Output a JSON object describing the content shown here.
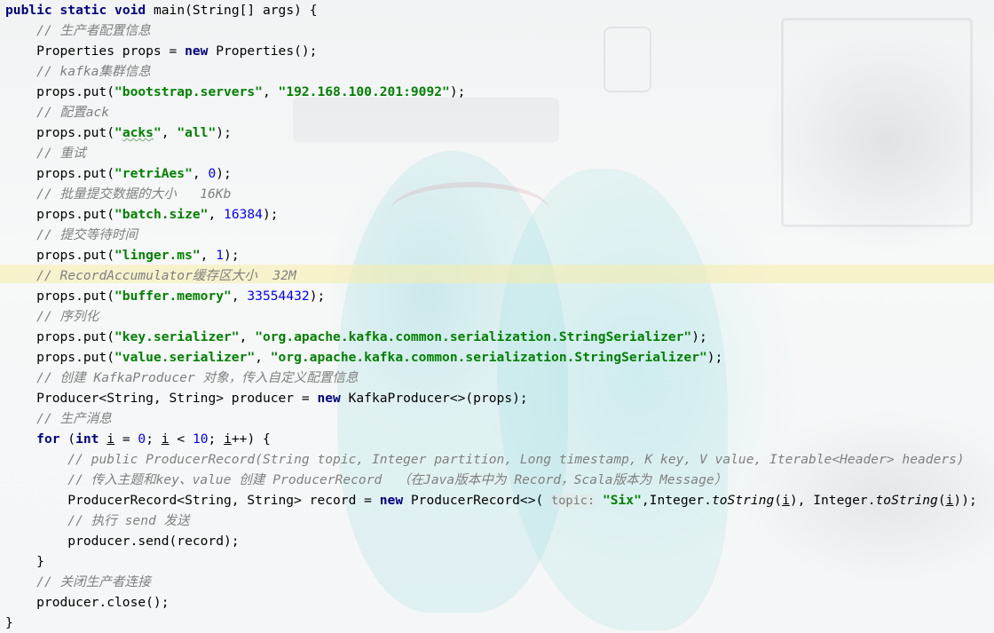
{
  "editor": {
    "lines": [
      {
        "segments": [
          {
            "t": "public",
            "c": "kw"
          },
          {
            "t": " "
          },
          {
            "t": "static",
            "c": "kw"
          },
          {
            "t": " "
          },
          {
            "t": "void",
            "c": "kw"
          },
          {
            "t": " main(String[] args) {"
          }
        ]
      },
      {
        "segments": [
          {
            "t": "    "
          },
          {
            "t": "// 生产者配置信息",
            "c": "cmt"
          }
        ]
      },
      {
        "segments": [
          {
            "t": "    Properties props = "
          },
          {
            "t": "new",
            "c": "kw"
          },
          {
            "t": " Properties();"
          }
        ]
      },
      {
        "segments": [
          {
            "t": "    "
          },
          {
            "t": "// kafka集群信息",
            "c": "cmt"
          }
        ]
      },
      {
        "segments": [
          {
            "t": "    props.put("
          },
          {
            "t": "\"bootstrap.servers\"",
            "c": "str"
          },
          {
            "t": ", "
          },
          {
            "t": "\"192.168.100.201:9092\"",
            "c": "str"
          },
          {
            "t": ");"
          }
        ]
      },
      {
        "segments": [
          {
            "t": "    "
          },
          {
            "t": "// 配置ack",
            "c": "cmt"
          }
        ]
      },
      {
        "segments": [
          {
            "t": "    props.put("
          },
          {
            "t": "\"",
            "c": "str"
          },
          {
            "t": "acks",
            "c": "str wavy"
          },
          {
            "t": "\"",
            "c": "str"
          },
          {
            "t": ", "
          },
          {
            "t": "\"all\"",
            "c": "str"
          },
          {
            "t": ");"
          }
        ]
      },
      {
        "segments": [
          {
            "t": "    "
          },
          {
            "t": "// 重试",
            "c": "cmt"
          }
        ]
      },
      {
        "segments": [
          {
            "t": "    props.put("
          },
          {
            "t": "\"retriAes\"",
            "c": "str"
          },
          {
            "t": ", "
          },
          {
            "t": "0",
            "c": "num"
          },
          {
            "t": ");"
          }
        ]
      },
      {
        "segments": [
          {
            "t": "    "
          },
          {
            "t": "// 批量提交数据的大小   16Kb",
            "c": "cmt"
          }
        ]
      },
      {
        "segments": [
          {
            "t": "    props.put("
          },
          {
            "t": "\"batch.size\"",
            "c": "str"
          },
          {
            "t": ", "
          },
          {
            "t": "16384",
            "c": "num"
          },
          {
            "t": ");"
          }
        ]
      },
      {
        "segments": [
          {
            "t": "    "
          },
          {
            "t": "// 提交等待时间",
            "c": "cmt"
          }
        ]
      },
      {
        "segments": [
          {
            "t": "    props.put("
          },
          {
            "t": "\"linger.ms\"",
            "c": "str"
          },
          {
            "t": ", "
          },
          {
            "t": "1",
            "c": "num"
          },
          {
            "t": ");"
          }
        ]
      },
      {
        "segments": [
          {
            "t": "    "
          },
          {
            "t": "// RecordAccumulator缓存区大小  32M",
            "c": "cmt"
          }
        ]
      },
      {
        "segments": [
          {
            "t": "    props.put("
          },
          {
            "t": "\"buffer.memory\"",
            "c": "str"
          },
          {
            "t": ", "
          },
          {
            "t": "33554432",
            "c": "num"
          },
          {
            "t": ");"
          }
        ]
      },
      {
        "segments": [
          {
            "t": "    "
          },
          {
            "t": "// 序列化",
            "c": "cmt"
          }
        ]
      },
      {
        "segments": [
          {
            "t": "    props.put("
          },
          {
            "t": "\"key.serializer\"",
            "c": "str"
          },
          {
            "t": ", "
          },
          {
            "t": "\"org.apache.kafka.common.serialization.StringSerializer\"",
            "c": "str"
          },
          {
            "t": ");"
          }
        ]
      },
      {
        "segments": [
          {
            "t": "    props.put("
          },
          {
            "t": "\"value.serializer\"",
            "c": "str"
          },
          {
            "t": ", "
          },
          {
            "t": "\"org.apache.kafka.common.serialization.StringSerializer\"",
            "c": "str"
          },
          {
            "t": ");"
          }
        ]
      },
      {
        "segments": [
          {
            "t": "    "
          },
          {
            "t": "// 创建 KafkaProducer 对象，传入自定义配置信息",
            "c": "cmt"
          }
        ]
      },
      {
        "segments": [
          {
            "t": "    Producer<String, String> producer = "
          },
          {
            "t": "new",
            "c": "kw"
          },
          {
            "t": " KafkaProducer<>(props);"
          }
        ]
      },
      {
        "segments": [
          {
            "t": "    "
          },
          {
            "t": "// 生产消息",
            "c": "cmt"
          }
        ]
      },
      {
        "segments": [
          {
            "t": "    "
          },
          {
            "t": "for",
            "c": "kw"
          },
          {
            "t": " ("
          },
          {
            "t": "int",
            "c": "kw"
          },
          {
            "t": " "
          },
          {
            "t": "i",
            "c": "uvar"
          },
          {
            "t": " = "
          },
          {
            "t": "0",
            "c": "num"
          },
          {
            "t": "; "
          },
          {
            "t": "i",
            "c": "uvar"
          },
          {
            "t": " < "
          },
          {
            "t": "10",
            "c": "num"
          },
          {
            "t": "; "
          },
          {
            "t": "i",
            "c": "uvar"
          },
          {
            "t": "++) {"
          }
        ]
      },
      {
        "segments": [
          {
            "t": "        "
          },
          {
            "t": "// public ProducerRecord(String topic, Integer partition, Long timestamp, K key, V value, Iterable<Header> headers)",
            "c": "cmt"
          }
        ]
      },
      {
        "segments": [
          {
            "t": "        "
          },
          {
            "t": "// 传入主题和key、value 创建 ProducerRecord  （在Java版本中为 Record，Scala版本为 Message）",
            "c": "cmt"
          }
        ]
      },
      {
        "segments": [
          {
            "t": "        ProducerRecord<String, String> record = "
          },
          {
            "t": "new",
            "c": "kw"
          },
          {
            "t": " ProducerRecord<>( "
          },
          {
            "t": "topic:",
            "c": "hint"
          },
          {
            "t": " "
          },
          {
            "t": "\"Six\"",
            "c": "str"
          },
          {
            "t": ",Integer."
          },
          {
            "t": "toString",
            "c": "mcall"
          },
          {
            "t": "("
          },
          {
            "t": "i",
            "c": "uvar"
          },
          {
            "t": "), Integer."
          },
          {
            "t": "toString",
            "c": "mcall"
          },
          {
            "t": "("
          },
          {
            "t": "i",
            "c": "uvar"
          },
          {
            "t": "));"
          }
        ]
      },
      {
        "segments": [
          {
            "t": "        "
          },
          {
            "t": "// 执行 send 发送",
            "c": "cmt"
          }
        ]
      },
      {
        "segments": [
          {
            "t": "        producer.send(record);"
          }
        ]
      },
      {
        "segments": [
          {
            "t": "    }"
          }
        ]
      },
      {
        "segments": [
          {
            "t": "    "
          },
          {
            "t": "// 关闭生产者连接",
            "c": "cmt"
          }
        ]
      },
      {
        "segments": [
          {
            "t": "    producer.close();"
          }
        ]
      },
      {
        "segments": [
          {
            "t": "}"
          }
        ]
      }
    ]
  }
}
